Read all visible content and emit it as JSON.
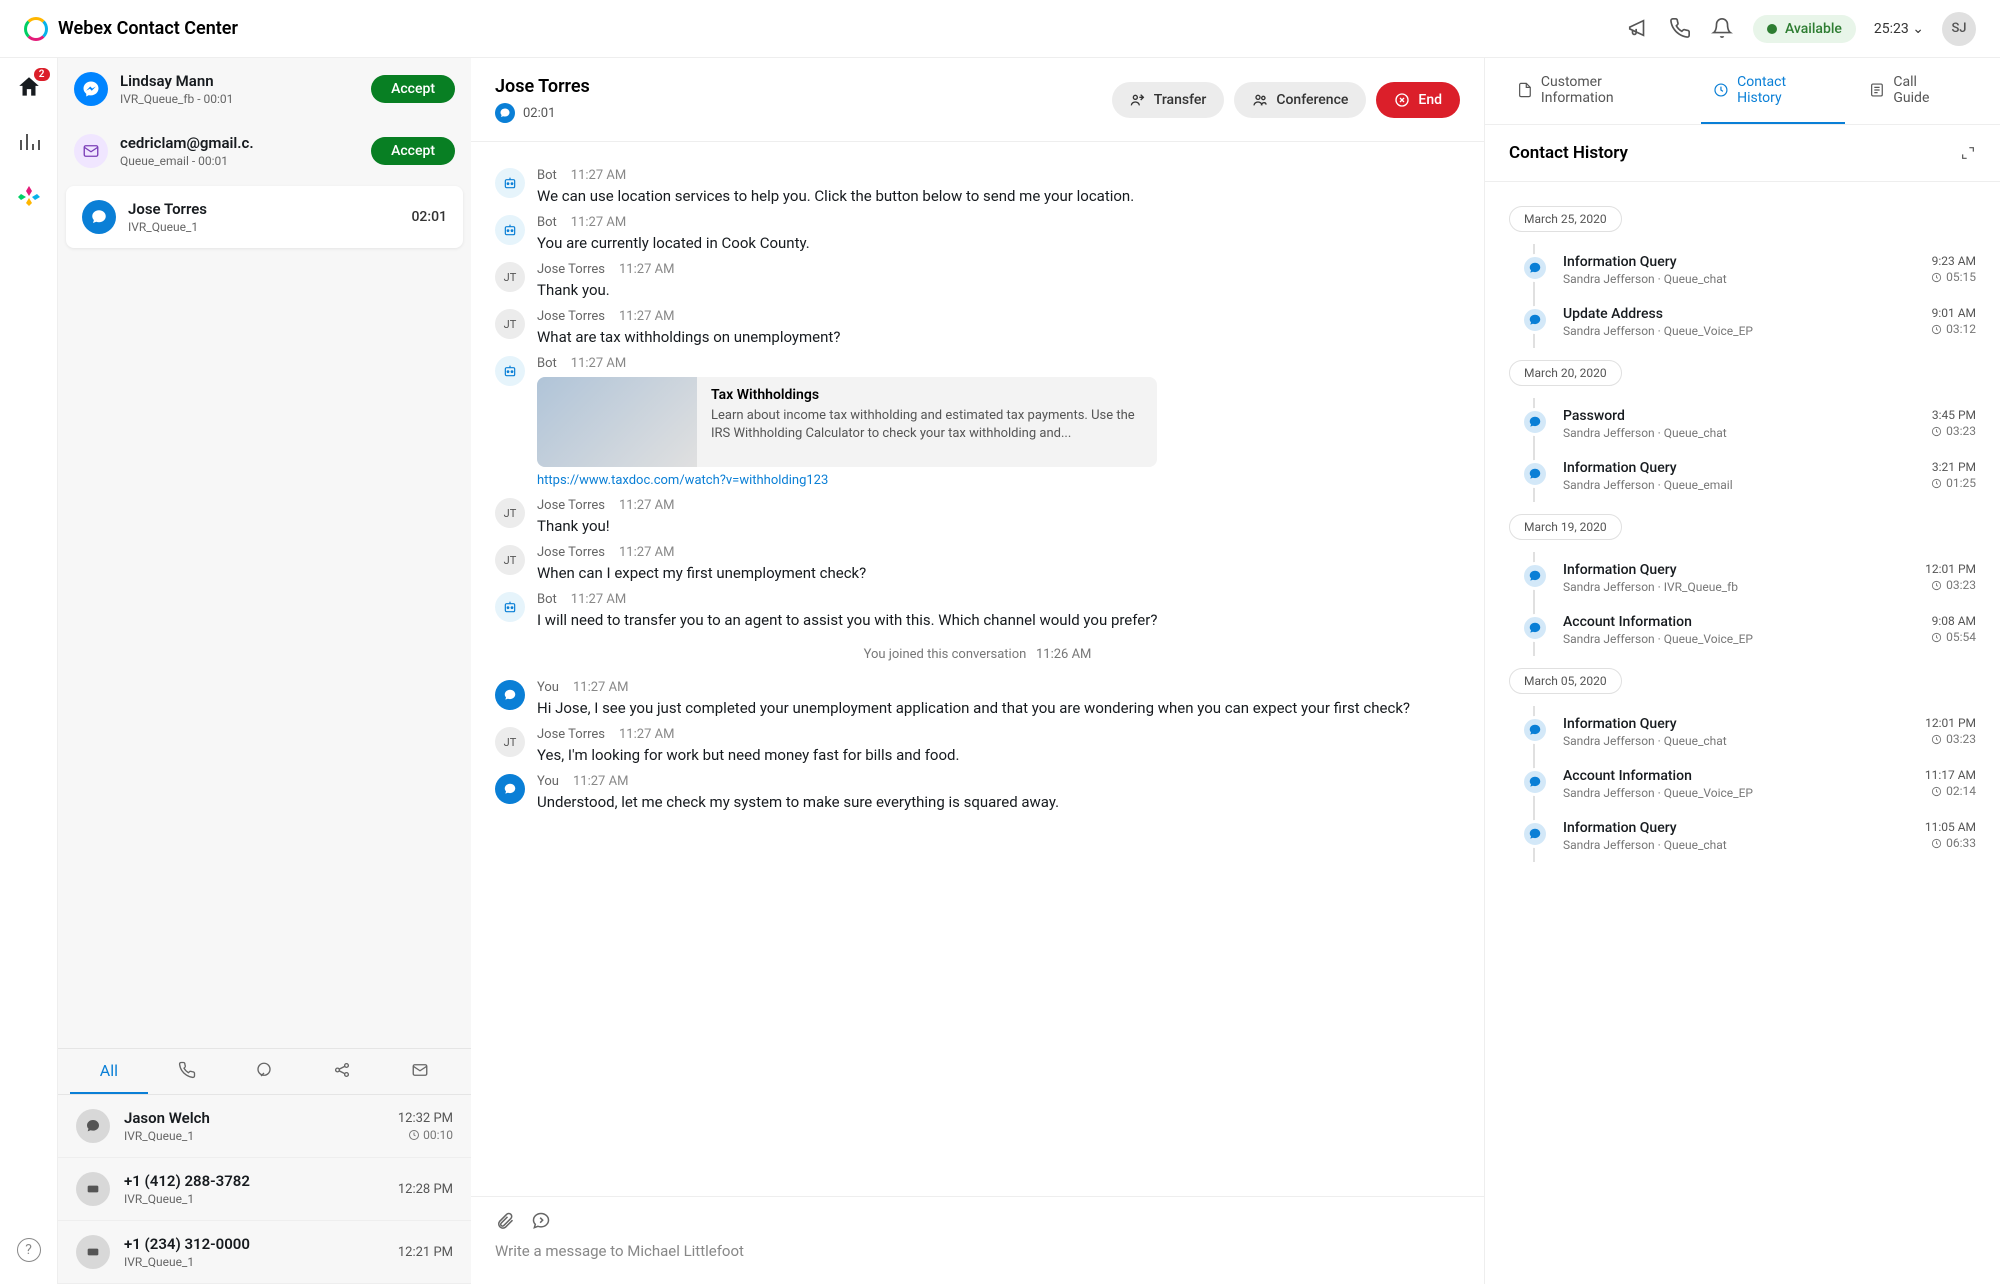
{
  "app_title": "Webex Contact Center",
  "topbar": {
    "status_label": "Available",
    "session_timer": "25:23",
    "agent_initials": "SJ"
  },
  "rail": {
    "home_badge": "2"
  },
  "tasks": {
    "pending": [
      {
        "name": "Lindsay Mann",
        "sub": "IVR_Queue_fb - 00:01",
        "action": "Accept",
        "channel": "fb"
      },
      {
        "name": "cedriclam@gmail.c.",
        "sub": "Queue_email - 00:01",
        "action": "Accept",
        "channel": "email"
      }
    ],
    "active": {
      "name": "Jose Torres",
      "sub": "IVR_Queue_1",
      "timer": "02:01",
      "channel": "chat"
    }
  },
  "recent_tabs": {
    "label_all": "All"
  },
  "recent": [
    {
      "name": "Jason Welch",
      "sub": "IVR_Queue_1",
      "time": "12:32 PM",
      "dur": "00:10"
    },
    {
      "name": "+1 (412) 288-3782",
      "sub": "IVR_Queue_1",
      "time": "12:28 PM",
      "dur": ""
    },
    {
      "name": "+1 (234) 312-0000",
      "sub": "IVR_Queue_1",
      "time": "12:21 PM",
      "dur": ""
    }
  ],
  "conversation": {
    "contact_name": "Jose Torres",
    "timer": "02:01",
    "actions": {
      "transfer": "Transfer",
      "conference": "Conference",
      "end": "End"
    },
    "messages": [
      {
        "kind": "bot",
        "sender": "Bot",
        "time": "11:27 AM",
        "text": "We can use location services to help you.  Click the button below to send me your location."
      },
      {
        "kind": "bot",
        "sender": "Bot",
        "time": "11:27 AM",
        "text": "You are currently located in Cook County."
      },
      {
        "kind": "jt",
        "sender": "Jose Torres",
        "time": "11:27 AM",
        "text": "Thank you."
      },
      {
        "kind": "jt",
        "sender": "Jose Torres",
        "time": "11:27 AM",
        "text": "What are tax withholdings on unemployment?"
      },
      {
        "kind": "bot-rich",
        "sender": "Bot",
        "time": "11:27 AM",
        "card_title": "Tax Withholdings",
        "card_desc": "Learn about income tax withholding and estimated tax payments. Use the IRS Withholding Calculator to check your tax withholding and...",
        "card_link": "https://www.taxdoc.com/watch?v=withholding123"
      },
      {
        "kind": "jt",
        "sender": "Jose Torres",
        "time": "11:27 AM",
        "text": "Thank you!"
      },
      {
        "kind": "jt",
        "sender": "Jose Torres",
        "time": "11:27 AM",
        "text": "When can I expect my first unemployment check?"
      },
      {
        "kind": "bot",
        "sender": "Bot",
        "time": "11:27 AM",
        "text": "I will need to transfer you to an agent to assist you with this.  Which channel would you prefer?"
      },
      {
        "kind": "system",
        "text": "You joined this conversation",
        "time": "11:26 AM"
      },
      {
        "kind": "you",
        "sender": "You",
        "time": "11:27 AM",
        "text": "Hi Jose, I see you just completed your unemployment application and that you are wondering when you can expect your first check?"
      },
      {
        "kind": "jt",
        "sender": "Jose Torres",
        "time": "11:27 AM",
        "text": "Yes, I'm looking for work but need money fast for bills and food."
      },
      {
        "kind": "you",
        "sender": "You",
        "time": "11:27 AM",
        "text": "Understood, let me check my system to make sure everything is squared away."
      }
    ],
    "composer": {
      "placeholder": "Write a message to Michael Littlefoot"
    }
  },
  "rightpanel": {
    "tabs": {
      "customer_info": "Customer Information",
      "contact_history": "Contact History",
      "call_guide": "Call Guide"
    },
    "title": "Contact History",
    "groups": [
      {
        "date": "March 25, 2020",
        "items": [
          {
            "title": "Information Query",
            "sub": "Sandra Jefferson · Queue_chat",
            "time": "9:23 AM",
            "dur": "05:15"
          },
          {
            "title": "Update Address",
            "sub": "Sandra Jefferson · Queue_Voice_EP",
            "time": "9:01 AM",
            "dur": "03:12"
          }
        ]
      },
      {
        "date": "March 20, 2020",
        "items": [
          {
            "title": "Password",
            "sub": "Sandra Jefferson · Queue_chat",
            "time": "3:45 PM",
            "dur": "03:23"
          },
          {
            "title": "Information Query",
            "sub": "Sandra Jefferson · Queue_email",
            "time": "3:21 PM",
            "dur": "01:25"
          }
        ]
      },
      {
        "date": "March 19, 2020",
        "items": [
          {
            "title": "Information Query",
            "sub": "Sandra Jefferson · IVR_Queue_fb",
            "time": "12:01 PM",
            "dur": "03:23"
          },
          {
            "title": "Account Information",
            "sub": "Sandra Jefferson · Queue_Voice_EP",
            "time": "9:08 AM",
            "dur": "05:54"
          }
        ]
      },
      {
        "date": "March 05, 2020",
        "items": [
          {
            "title": "Information Query",
            "sub": "Sandra Jefferson · Queue_chat",
            "time": "12:01 PM",
            "dur": "03:23"
          },
          {
            "title": "Account Information",
            "sub": "Sandra Jefferson · Queue_Voice_EP",
            "time": "11:17 AM",
            "dur": "02:14"
          },
          {
            "title": "Information Query",
            "sub": "Sandra Jefferson · Queue_chat",
            "time": "11:05 AM",
            "dur": "06:33"
          }
        ]
      }
    ]
  }
}
